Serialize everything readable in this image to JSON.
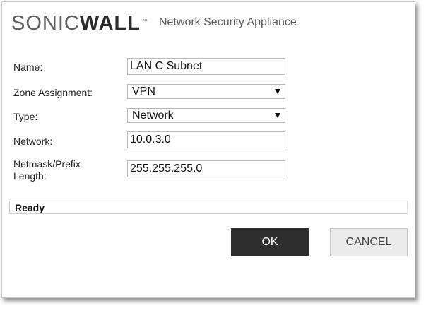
{
  "header": {
    "logo_sonic": "SONIC",
    "logo_wall": "WALL",
    "logo_tm": "™",
    "app_title": "Network Security Appliance"
  },
  "form": {
    "name": {
      "label": "Name:",
      "value": "LAN C Subnet"
    },
    "zone": {
      "label": "Zone Assignment:",
      "value": "VPN"
    },
    "type": {
      "label": "Type:",
      "value": "Network"
    },
    "network": {
      "label": "Network:",
      "value": "10.0.3.0"
    },
    "netmask": {
      "label": "Netmask/Prefix Length:",
      "value": "255.255.255.0"
    }
  },
  "status": {
    "text": "Ready"
  },
  "buttons": {
    "ok_label": "OK",
    "cancel_label": "CANCEL"
  },
  "colors": {
    "ok_background": "#2e2e2e",
    "cancel_background": "#ececec"
  }
}
